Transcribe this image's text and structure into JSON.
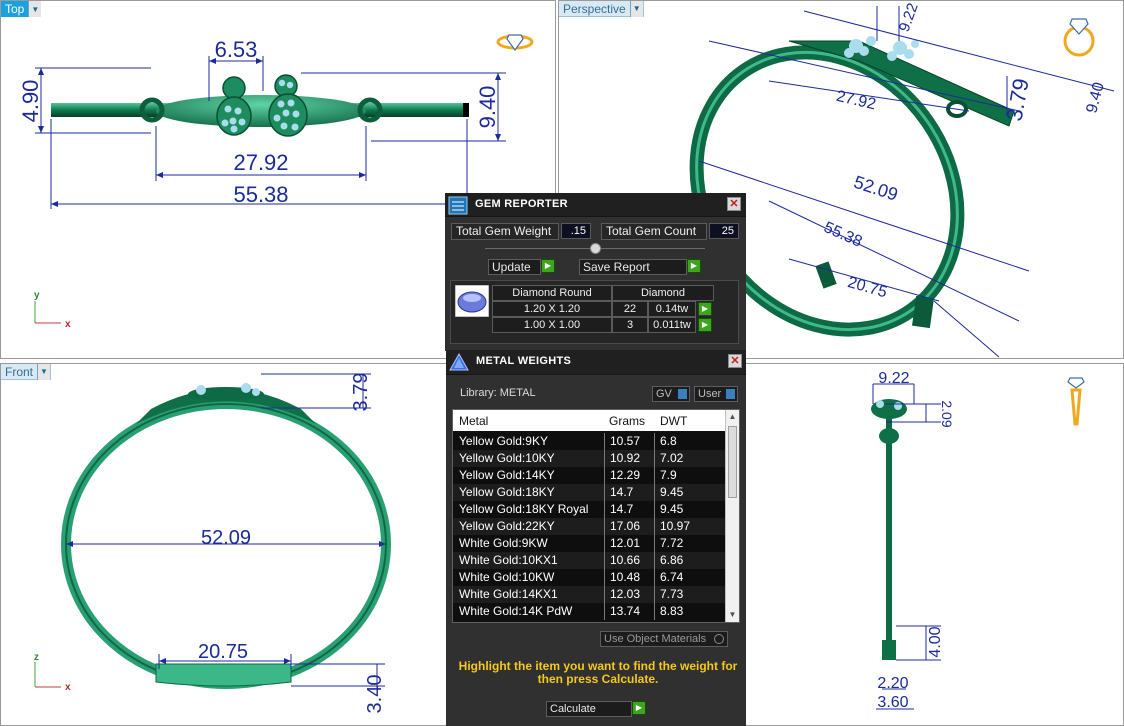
{
  "viewports": {
    "top": {
      "label": "Top",
      "dims": {
        "a": "6.53",
        "b": "4.90",
        "c": "9.40",
        "d": "27.92",
        "e": "55.38"
      },
      "axis_v": "y",
      "axis_h": "x"
    },
    "perspective": {
      "label": "Perspective",
      "dims": {
        "a": "9.22",
        "b": "3.79",
        "c": "9.40",
        "d": "27.92",
        "e": "52.09",
        "f": "55.38",
        "g": "20.75"
      }
    },
    "front": {
      "label": "Front",
      "dims": {
        "a": "3.79",
        "b": "52.09",
        "c": "20.75",
        "d": "3.40"
      },
      "axis_v": "z",
      "axis_h": "x"
    },
    "right": {
      "dims": {
        "a": "9.22",
        "b": "2.09",
        "c": "4.00",
        "d": "2.20",
        "e": "3.60"
      }
    }
  },
  "gem_reporter": {
    "title": "GEM REPORTER",
    "total_weight_label": "Total Gem Weight",
    "total_weight_value": ".15",
    "total_count_label": "Total Gem Count",
    "total_count_value": "25",
    "update_label": "Update",
    "save_report_label": "Save Report",
    "columns": [
      "Diamond Round",
      "Diamond"
    ],
    "rows": [
      {
        "size": "1.20 X 1.20",
        "count": "22",
        "weight": "0.14tw"
      },
      {
        "size": "1.00 X 1.00",
        "count": "3",
        "weight": "0.011tw"
      }
    ]
  },
  "metal_weights": {
    "title": "METAL WEIGHTS",
    "library_label": "Library:",
    "library_value": "METAL",
    "gv_label": "GV",
    "user_label": "User",
    "columns": {
      "metal": "Metal",
      "grams": "Grams",
      "dwt": "DWT"
    },
    "rows": [
      {
        "metal": "Yellow Gold:9KY",
        "grams": "10.57",
        "dwt": "6.8"
      },
      {
        "metal": "Yellow Gold:10KY",
        "grams": "10.92",
        "dwt": "7.02"
      },
      {
        "metal": "Yellow Gold:14KY",
        "grams": "12.29",
        "dwt": "7.9"
      },
      {
        "metal": "Yellow Gold:18KY",
        "grams": "14.7",
        "dwt": "9.45"
      },
      {
        "metal": "Yellow Gold:18KY Royal",
        "grams": "14.7",
        "dwt": "9.45"
      },
      {
        "metal": "Yellow Gold:22KY",
        "grams": "17.06",
        "dwt": "10.97"
      },
      {
        "metal": "White Gold:9KW",
        "grams": "12.01",
        "dwt": "7.72"
      },
      {
        "metal": "White Gold:10KX1",
        "grams": "10.66",
        "dwt": "6.86"
      },
      {
        "metal": "White Gold:10KW",
        "grams": "10.48",
        "dwt": "6.74"
      },
      {
        "metal": "White Gold:14KX1",
        "grams": "12.03",
        "dwt": "7.73"
      },
      {
        "metal": "White Gold:14K PdW",
        "grams": "13.74",
        "dwt": "8.83"
      }
    ],
    "use_object_materials_label": "Use Object Materials",
    "hint": "Highlight the item you want to find the weight for then press Calculate.",
    "calculate_label": "Calculate"
  },
  "colors": {
    "accent_tab": "#1aa1de",
    "dimension": "#1c2a9b",
    "model": "#0e6b4a",
    "panel_bg": "#303030",
    "hint_text": "#f7c81c",
    "ok_button": "#3ca51e"
  },
  "icons": [
    "ring-diamond-icon",
    "gem-reporter-icon",
    "metal-weights-icon",
    "gem-thumbnail-icon",
    "close-icon",
    "play-arrow-icon"
  ]
}
